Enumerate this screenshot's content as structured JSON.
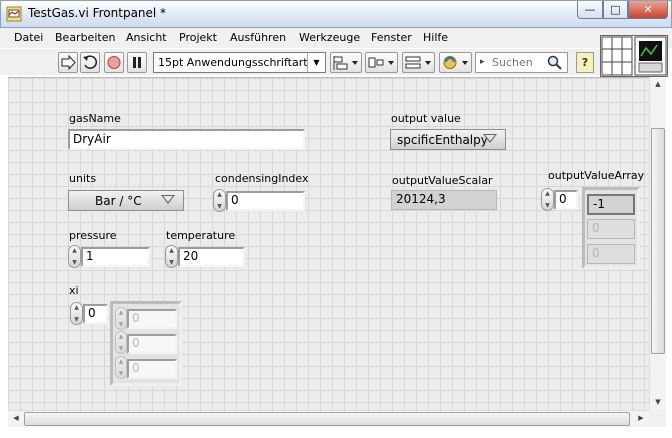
{
  "window": {
    "title": "TestGas.vi Frontpanel *",
    "minimize_glyph": "—",
    "maximize_glyph": "□",
    "close_glyph": "✕"
  },
  "menu": {
    "items": [
      "Datei",
      "Bearbeiten",
      "Ansicht",
      "Projekt",
      "Ausführen",
      "Werkzeuge",
      "Fenster",
      "Hilfe"
    ]
  },
  "toolbar": {
    "font_select": "15pt Anwendungsschriftart",
    "search_placeholder": "Suchen",
    "help_glyph": "?",
    "dropdown_glyph": "▼"
  },
  "panel": {
    "gasName": {
      "label": "gasName",
      "value": "DryAir"
    },
    "units": {
      "label": "units",
      "value": "Bar / °C"
    },
    "condensingIndex": {
      "label": "condensingIndex",
      "value": "0"
    },
    "pressure": {
      "label": "pressure",
      "value": "1"
    },
    "temperature": {
      "label": "temperature",
      "value": "20"
    },
    "xi": {
      "label": "xi",
      "index": "0",
      "values": [
        "0",
        "0",
        "0"
      ]
    },
    "output_value": {
      "label": "output value",
      "value": "spcificEnthalpy"
    },
    "outputValueScalar": {
      "label": "outputValueScalar",
      "value": "20124,3"
    },
    "outputValueArray": {
      "label": "outputValueArray",
      "index": "0",
      "values": [
        "-1",
        "0",
        "0"
      ]
    }
  },
  "colors": {
    "titlebar": "#dde8f5",
    "panel_grid": "#d8d8d8",
    "indicator": "#d2d2d2",
    "help_yellow": "#f6f1b8"
  }
}
